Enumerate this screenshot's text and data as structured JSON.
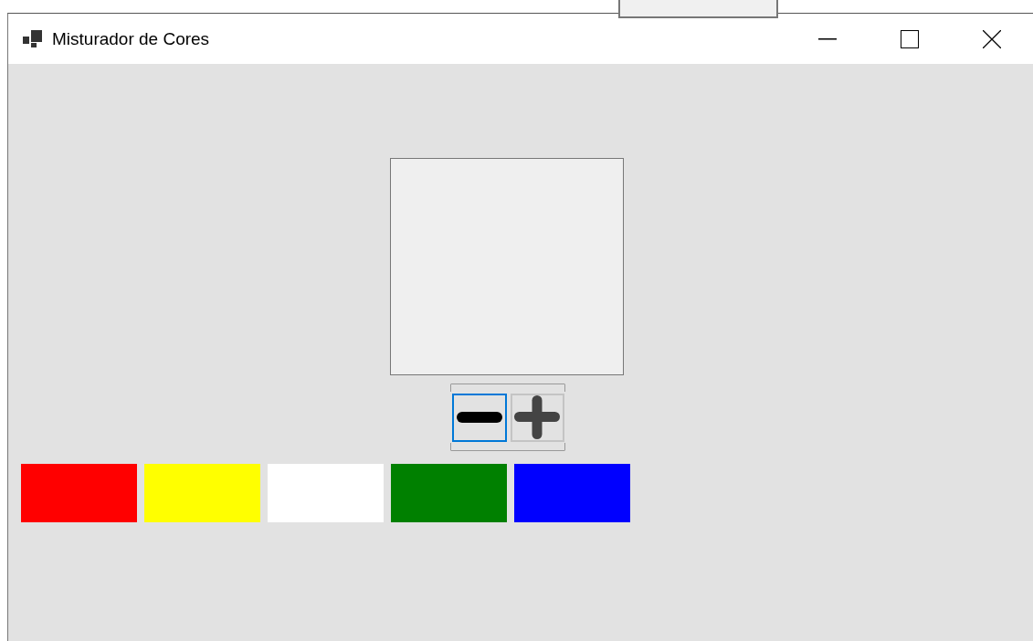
{
  "window": {
    "title": "Misturador de Cores"
  },
  "preview": {
    "color": "#efefef"
  },
  "buttons": [
    {
      "kind": "minus",
      "selected": true
    },
    {
      "kind": "plus",
      "selected": false
    }
  ],
  "swatches": [
    {
      "color": "#ff0000"
    },
    {
      "color": "#ffff00"
    },
    {
      "color": "#ffffff"
    },
    {
      "color": "#008000"
    },
    {
      "color": "#0000ff"
    }
  ]
}
